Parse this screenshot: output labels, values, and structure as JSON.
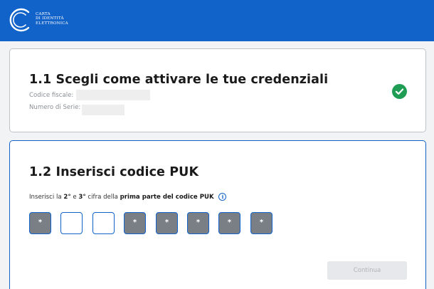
{
  "header": {
    "logo_lines": [
      "CARTA",
      "DI IDENTITÀ",
      "ELETTRONICA"
    ]
  },
  "step1": {
    "title": "1.1 Scegli come attivare le tue credenziali",
    "codice_fiscale_label": "Codice fiscale:",
    "numero_serie_label": "Numero di Serie:",
    "status_icon": "check-circle-icon",
    "status_color": "#1f9d55"
  },
  "step2": {
    "title": "1.2 Inserisci codice PUK",
    "instruction": {
      "pre": "Inserisci la ",
      "d1": "2°",
      "mid1": " e ",
      "d2": "3°",
      "mid2": " cifra della ",
      "bold": "prima parte del codice PUK"
    },
    "info_icon": "info-icon",
    "digits": [
      "*",
      "",
      "",
      "*",
      "*",
      "*",
      "*",
      "*"
    ],
    "continue_label": "Continua"
  },
  "colors": {
    "brand": "#1162c9",
    "masked_digit": "#7a7f86",
    "disabled_button": "#e6e8eb"
  }
}
